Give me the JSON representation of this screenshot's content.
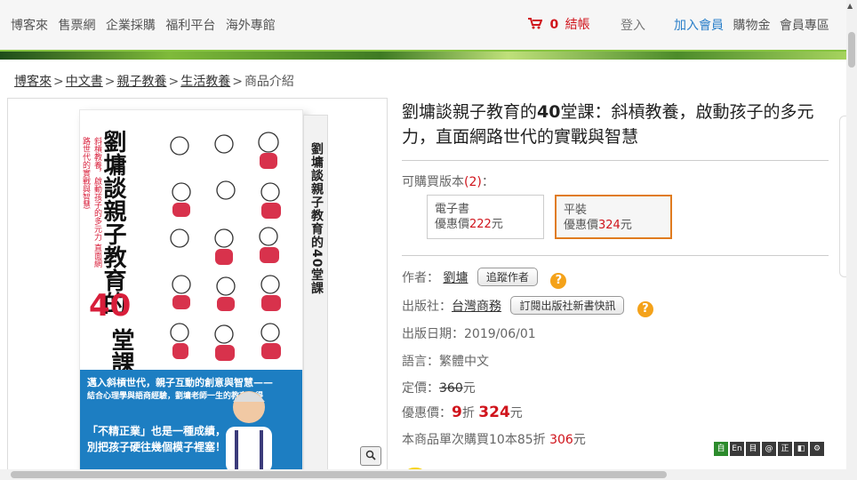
{
  "topnav": {
    "links": [
      "博客來",
      "售票網",
      "企業採購",
      "福利平台",
      "海外專館"
    ],
    "cart_count": "0",
    "checkout": "結帳",
    "login": "登入",
    "join": "加入會員",
    "coupon": "購物金",
    "member": "會員專區"
  },
  "breadcrumb": {
    "items": [
      "博客來",
      "中文書",
      "親子教養",
      "生活教養"
    ],
    "current": "商品介紹",
    "separator": ">"
  },
  "cover": {
    "title": "劉墉談親子教育的",
    "number": "40",
    "suffix": "堂課",
    "subtitle": "斜槓教養，啟動孩子的多元力 直面網路世代的實戰與智慧",
    "spine": "劉墉談親子教育的40堂課",
    "blurb_1": "邁入斜槓世代，親子互動的創意與智慧——",
    "blurb_2": "結合心理學與語商經驗，劉墉老師一生的教育心得",
    "blurb_3": "「不精正業」也是一種成績，",
    "blurb_4": "別把孩子硬往幾個模子裡塞！"
  },
  "product": {
    "title_a": "劉墉談親子教育的",
    "title_b": "40",
    "title_c": "堂課：斜槓教養，啟動孩子的多元力，直面網路世代的實戰與智慧",
    "versions_label": "可購買版本",
    "versions_count": "(2)",
    "versions_colon": "：",
    "versions": [
      {
        "name": "電子書",
        "price_label": "優惠價",
        "price": "222",
        "unit": "元"
      },
      {
        "name": "平裝",
        "price_label": "優惠價",
        "price": "324",
        "unit": "元"
      }
    ],
    "author_label": "作者：",
    "author": "劉墉",
    "follow_author": "追蹤作者",
    "publisher_label": "出版社：",
    "publisher": "台灣商務",
    "subscribe_publisher": "訂閱出版社新書快訊",
    "date_label": "出版日期：",
    "date": "2019/06/01",
    "lang_label": "語言：",
    "lang": "繁體中文",
    "list_price_label": "定價：",
    "list_price": "360",
    "list_price_unit": "元",
    "sale_label": "優惠價：",
    "discount": "9",
    "discount_unit": "折",
    "sale_price": "324",
    "sale_unit": "元",
    "bulk_text": "本商品單次購買10本85折",
    "bulk_price": "306",
    "bulk_unit": "元"
  },
  "toolbar": [
    "自",
    "En",
    "目",
    "@",
    "正",
    "◧",
    "⚙"
  ],
  "colors": {
    "accent_red": "#d0141c",
    "join_blue": "#2a7fc9",
    "orange": "#e07b1f",
    "banner_green": "#86c440"
  }
}
